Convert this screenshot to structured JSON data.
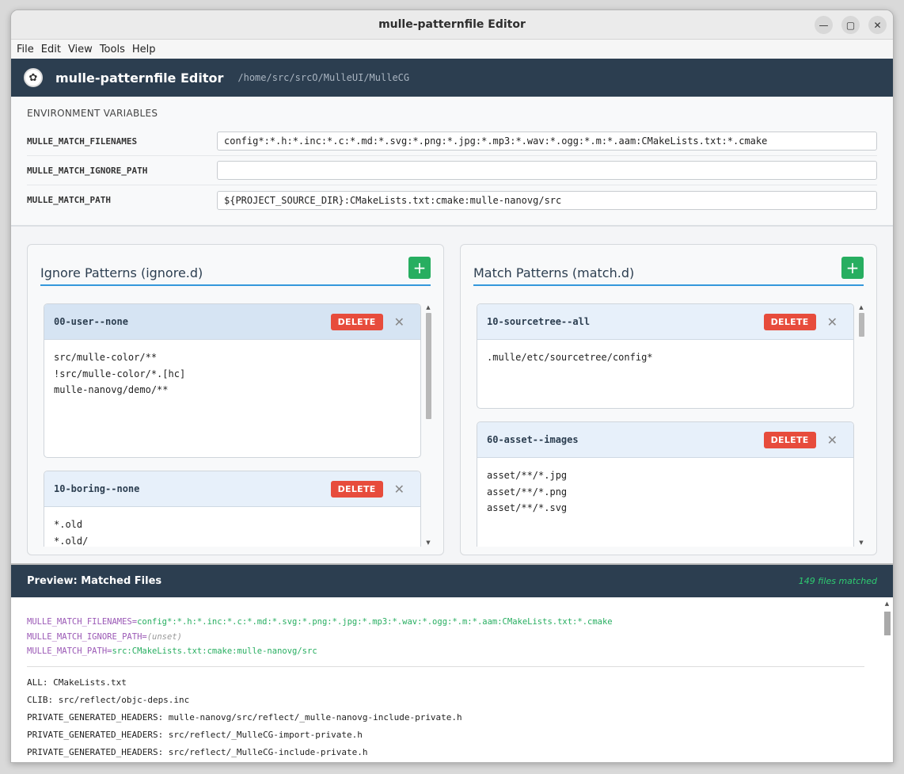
{
  "window": {
    "title": "mulle-patternfile Editor",
    "controls": [
      "—",
      "▢",
      "✕"
    ]
  },
  "menu": [
    "File",
    "Edit",
    "View",
    "Tools",
    "Help"
  ],
  "header": {
    "title": "mulle-patternfile Editor",
    "path": "/home/src/srcO/MulleUI/MulleCG"
  },
  "env": {
    "heading": "ENVIRONMENT VARIABLES",
    "rows": [
      {
        "label": "MULLE_MATCH_FILENAMES",
        "value": "config*:*.h:*.inc:*.c:*.md:*.svg:*.png:*.jpg:*.mp3:*.wav:*.ogg:*.m:*.aam:CMakeLists.txt:*.cmake"
      },
      {
        "label": "MULLE_MATCH_IGNORE_PATH",
        "value": ""
      },
      {
        "label": "MULLE_MATCH_PATH",
        "value": "${PROJECT_SOURCE_DIR}:CMakeLists.txt:cmake:mulle-nanovg/src"
      }
    ]
  },
  "ignore_panel": {
    "title": "Ignore Patterns (ignore.d)",
    "add_label": "+",
    "cards": [
      {
        "name": "00-user--none",
        "delete_label": "DELETE",
        "close_label": "✕",
        "lines": [
          "src/mulle-color/**",
          "!src/mulle-color/*.[hc]",
          "mulle-nanovg/demo/**"
        ]
      },
      {
        "name": "10-boring--none",
        "delete_label": "DELETE",
        "close_label": "✕",
        "lines": [
          "*.old",
          "*.old/"
        ]
      }
    ]
  },
  "match_panel": {
    "title": "Match Patterns (match.d)",
    "add_label": "+",
    "cards": [
      {
        "name": "10-sourcetree--all",
        "delete_label": "DELETE",
        "close_label": "✕",
        "lines": [
          ".mulle/etc/sourcetree/config*"
        ]
      },
      {
        "name": "60-asset--images",
        "delete_label": "DELETE",
        "close_label": "✕",
        "lines": [
          "asset/**/*.jpg",
          "asset/**/*.png",
          "asset/**/*.svg"
        ]
      }
    ]
  },
  "preview": {
    "title": "Preview: Matched Files",
    "count": "149 files matched",
    "env_lines": [
      {
        "key": "MULLE_MATCH_FILENAMES=",
        "value": "config*:*.h:*.inc:*.c:*.md:*.svg:*.png:*.jpg:*.mp3:*.wav:*.ogg:*.m:*.aam:CMakeLists.txt:*.cmake"
      },
      {
        "key": "MULLE_MATCH_IGNORE_PATH=",
        "unset": "(unset)"
      },
      {
        "key": "MULLE_MATCH_PATH=",
        "value": "src:CMakeLists.txt:cmake:mulle-nanovg/src"
      }
    ],
    "files": [
      "ALL: CMakeLists.txt",
      "CLIB: src/reflect/objc-deps.inc",
      "PRIVATE_GENERATED_HEADERS: mulle-nanovg/src/reflect/_mulle-nanovg-include-private.h",
      "PRIVATE_GENERATED_HEADERS: src/reflect/_MulleCG-import-private.h",
      "PRIVATE_GENERATED_HEADERS: src/reflect/_MulleCG-include-private.h"
    ]
  },
  "colors": {
    "header_bg": "#2c3e50",
    "accent": "#3498db",
    "add_button": "#27ae60",
    "delete_button": "#e74c3c",
    "preview_key": "#9b59b6",
    "preview_value": "#27ae60"
  }
}
